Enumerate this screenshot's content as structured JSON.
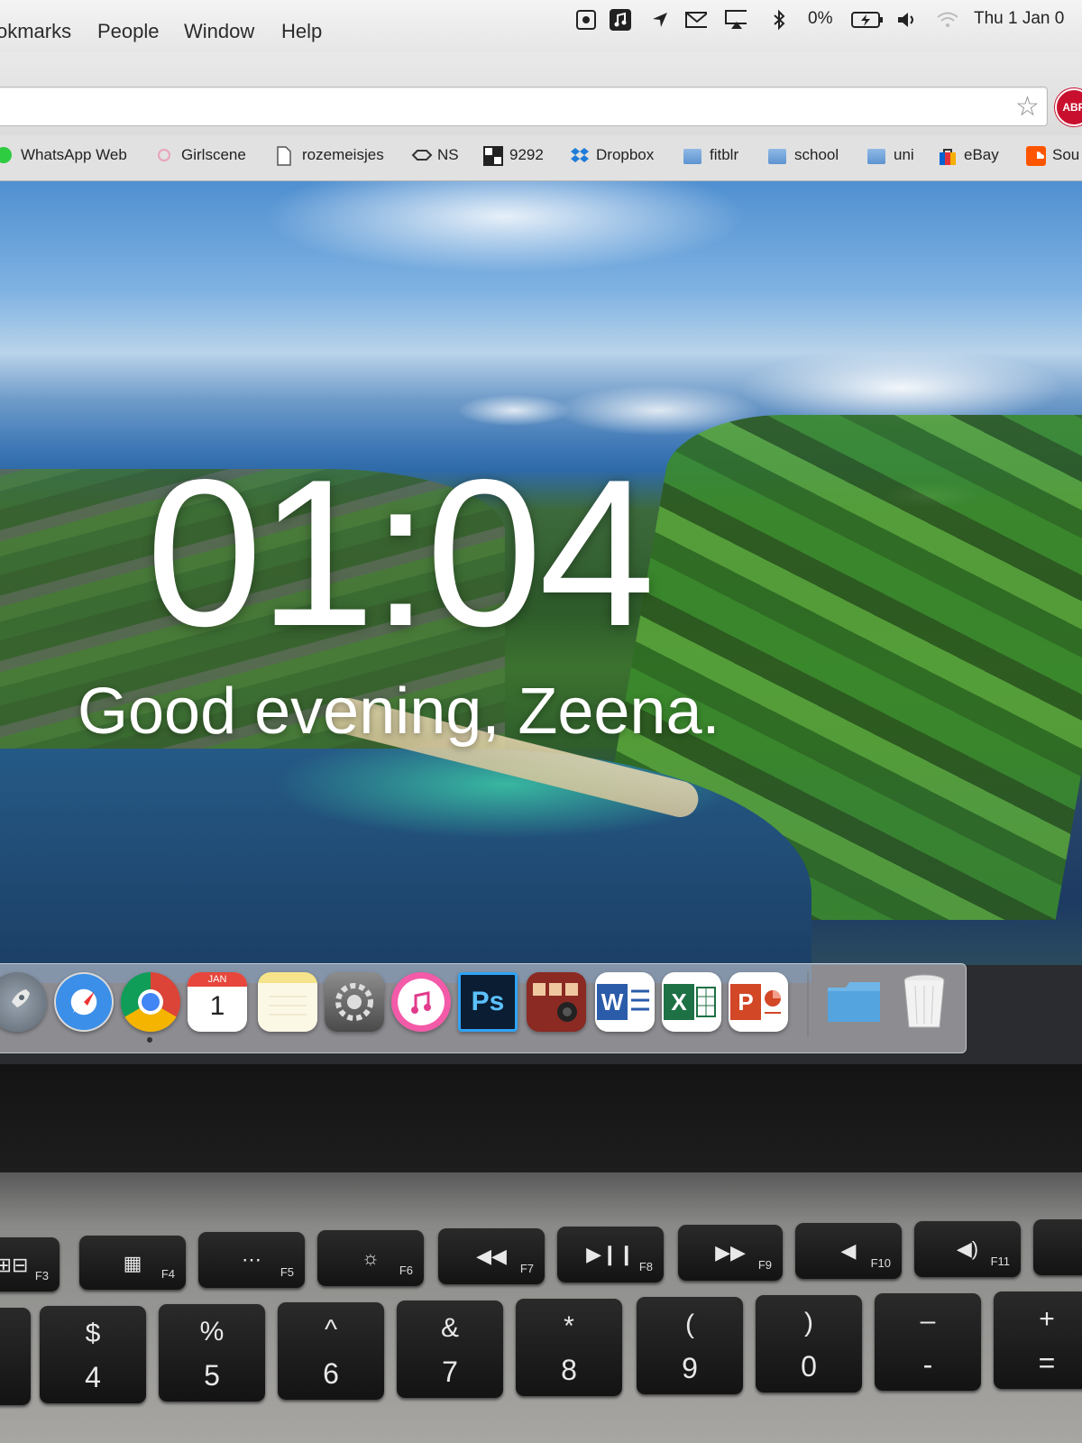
{
  "menubar": {
    "items": [
      "okmarks",
      "People",
      "Window",
      "Help"
    ],
    "battery": "0%",
    "datetime": "Thu 1 Jan 0"
  },
  "browser": {
    "abp_label": "ABP",
    "bookmarks": [
      "WhatsApp Web",
      "Girlscene",
      "rozemeisjes",
      "NS",
      "9292",
      "Dropbox",
      "fitblr",
      "school",
      "uni",
      "eBay",
      "Sou"
    ]
  },
  "newtab": {
    "time": "01:04",
    "greeting": "Good evening, Zeena."
  },
  "dock": {
    "calendar_month": "JAN",
    "calendar_day": "1",
    "ps_label": "Ps",
    "word_label": "W",
    "excel_label": "X",
    "ppt_label": "P"
  },
  "keyboard": {
    "fkeys": [
      {
        "glyph": "⊞⊟",
        "label": "F3"
      },
      {
        "glyph": "▦",
        "label": "F4"
      },
      {
        "glyph": "⋯",
        "label": "F5"
      },
      {
        "glyph": "☼",
        "label": "F6"
      },
      {
        "glyph": "◀◀",
        "label": "F7"
      },
      {
        "glyph": "▶❙❙",
        "label": "F8"
      },
      {
        "glyph": "▶▶",
        "label": "F9"
      },
      {
        "glyph": "◀",
        "label": "F10"
      },
      {
        "glyph": "◀)",
        "label": "F11"
      }
    ],
    "numkeys": [
      {
        "top": "$",
        "bottom": "4"
      },
      {
        "top": "%",
        "bottom": "5"
      },
      {
        "top": "^",
        "bottom": "6"
      },
      {
        "top": "&",
        "bottom": "7"
      },
      {
        "top": "*",
        "bottom": "8"
      },
      {
        "top": "(",
        "bottom": "9"
      },
      {
        "top": ")",
        "bottom": "0"
      },
      {
        "top": "–",
        "bottom": "-"
      },
      {
        "top": "+",
        "bottom": "="
      }
    ]
  }
}
